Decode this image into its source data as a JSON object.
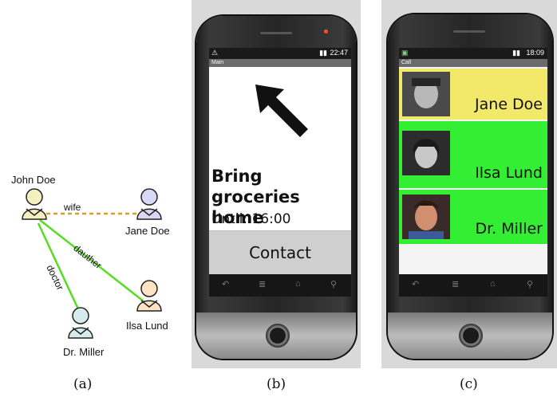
{
  "panel_a": {
    "nodes": {
      "john": "John Doe",
      "jane": "Jane Doe",
      "ilsa": "Ilsa Lund",
      "miller": "Dr. Miller"
    },
    "edges": {
      "wife": "wife",
      "dauther": "dauther",
      "doctor": "doctor"
    },
    "colors": {
      "wife_edge": "#d4a028",
      "family_edge": "#55dd22",
      "doctor_edge": "#55dd22"
    }
  },
  "panel_b": {
    "status_time": "22:47",
    "screen_title": "Main",
    "task_title": "Bring groceries home",
    "task_until": "Until: 16:00",
    "contact_button": "Contact",
    "icons": [
      "arrow-pointer-icon",
      "back-icon",
      "menu-icon",
      "home-icon",
      "search-icon"
    ]
  },
  "panel_c": {
    "status_time": "18:09",
    "screen_title": "Call",
    "contacts": [
      {
        "name": "Jane Doe",
        "color": "#f2e96a"
      },
      {
        "name": "Ilsa Lund",
        "color": "#33ee33"
      },
      {
        "name": "Dr. Miller",
        "color": "#33ee33"
      }
    ]
  },
  "captions": {
    "a": "(a)",
    "b": "(b)",
    "c": "(c)"
  }
}
